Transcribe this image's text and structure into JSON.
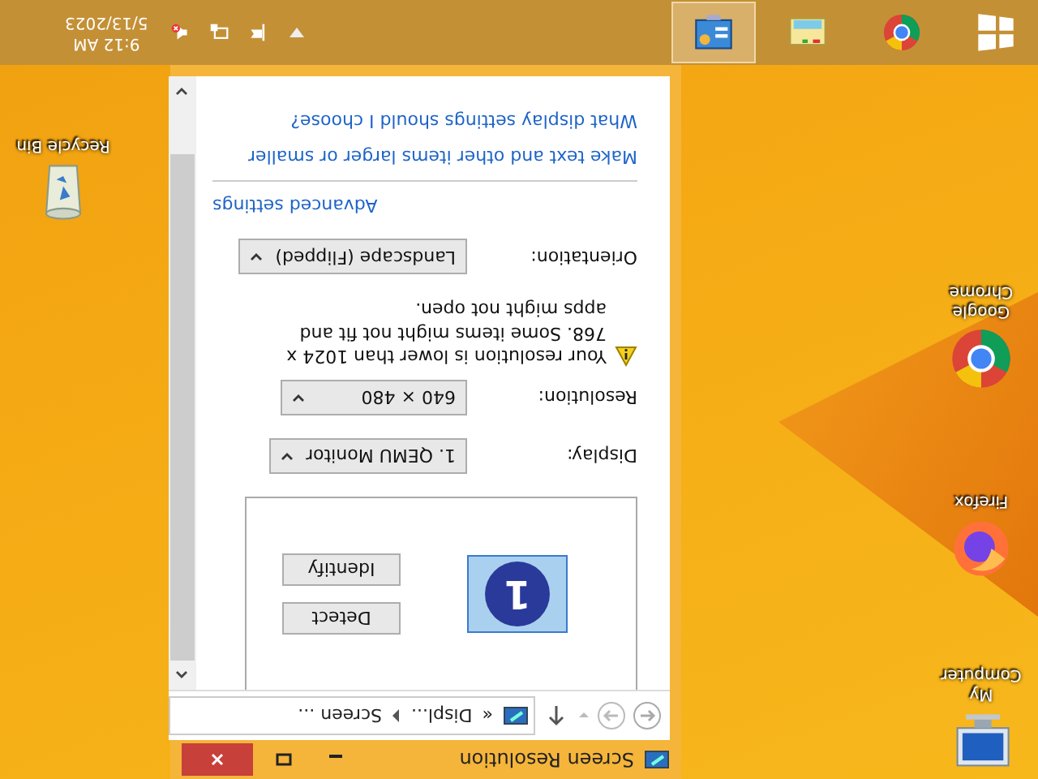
{
  "screen": {
    "flipped": true
  },
  "desktop_icons": [
    {
      "kind": "computer",
      "label": "My Computer"
    },
    {
      "kind": "firefox",
      "label": "Firefox"
    },
    {
      "kind": "chrome",
      "label": "Google Chrome"
    },
    {
      "kind": "recycle-bin",
      "label": "Recycle Bin"
    }
  ],
  "window": {
    "title": "Screen Resolution",
    "breadcrumb": {
      "overflow": "«",
      "items": [
        "Displ...",
        "Screen ..."
      ]
    }
  },
  "monitor": {
    "number": "1"
  },
  "buttons": [
    "Detect",
    "Identify"
  ],
  "settings": [
    {
      "label": "Display:",
      "value": "1. QEMU Monitor"
    },
    {
      "label": "Resolution:",
      "value": "640 × 480"
    },
    {
      "label": "Orientation:",
      "value": "Landscape (Flipped)"
    }
  ],
  "warning": "Your resolution is lower than 1024 x 768. Some items might not fit and apps might not open.",
  "advanced_link": "Advanced settings",
  "links": [
    "Make text and other items larger or smaller",
    "What display settings should I choose?"
  ],
  "taskbar": {
    "apps": [
      {
        "kind": "start",
        "selected": false
      },
      {
        "kind": "chrome",
        "selected": false
      },
      {
        "kind": "explorer",
        "selected": false
      },
      {
        "kind": "control-panel",
        "selected": true
      }
    ],
    "time": "9:12 AM",
    "date": "5/13/2023"
  }
}
